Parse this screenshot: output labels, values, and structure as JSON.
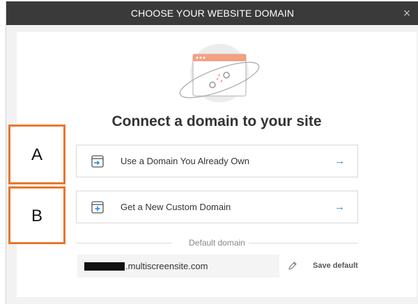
{
  "dialog": {
    "title": "CHOOSE YOUR WEBSITE DOMAIN",
    "close_icon": "close-icon"
  },
  "main": {
    "heading": "Connect a domain to your site",
    "illustration": "broken-link-illustration"
  },
  "options": [
    {
      "label": "Use a Domain You Already Own",
      "icon": "domain-connect-icon",
      "arrow": "→"
    },
    {
      "label": "Get a New Custom Domain",
      "icon": "domain-add-icon",
      "arrow": "→"
    }
  ],
  "default_domain": {
    "section_label": "Default domain",
    "value": ".multiscreensite.com",
    "edit_icon": "pencil-icon",
    "save_label": "Save default"
  },
  "annotations": [
    {
      "label": "A"
    },
    {
      "label": "B"
    }
  ],
  "colors": {
    "titlebar": "#3a3a3a",
    "accent": "#1e88e5",
    "annotation_border": "#e8772e",
    "illustration_accent": "#f4a081"
  }
}
